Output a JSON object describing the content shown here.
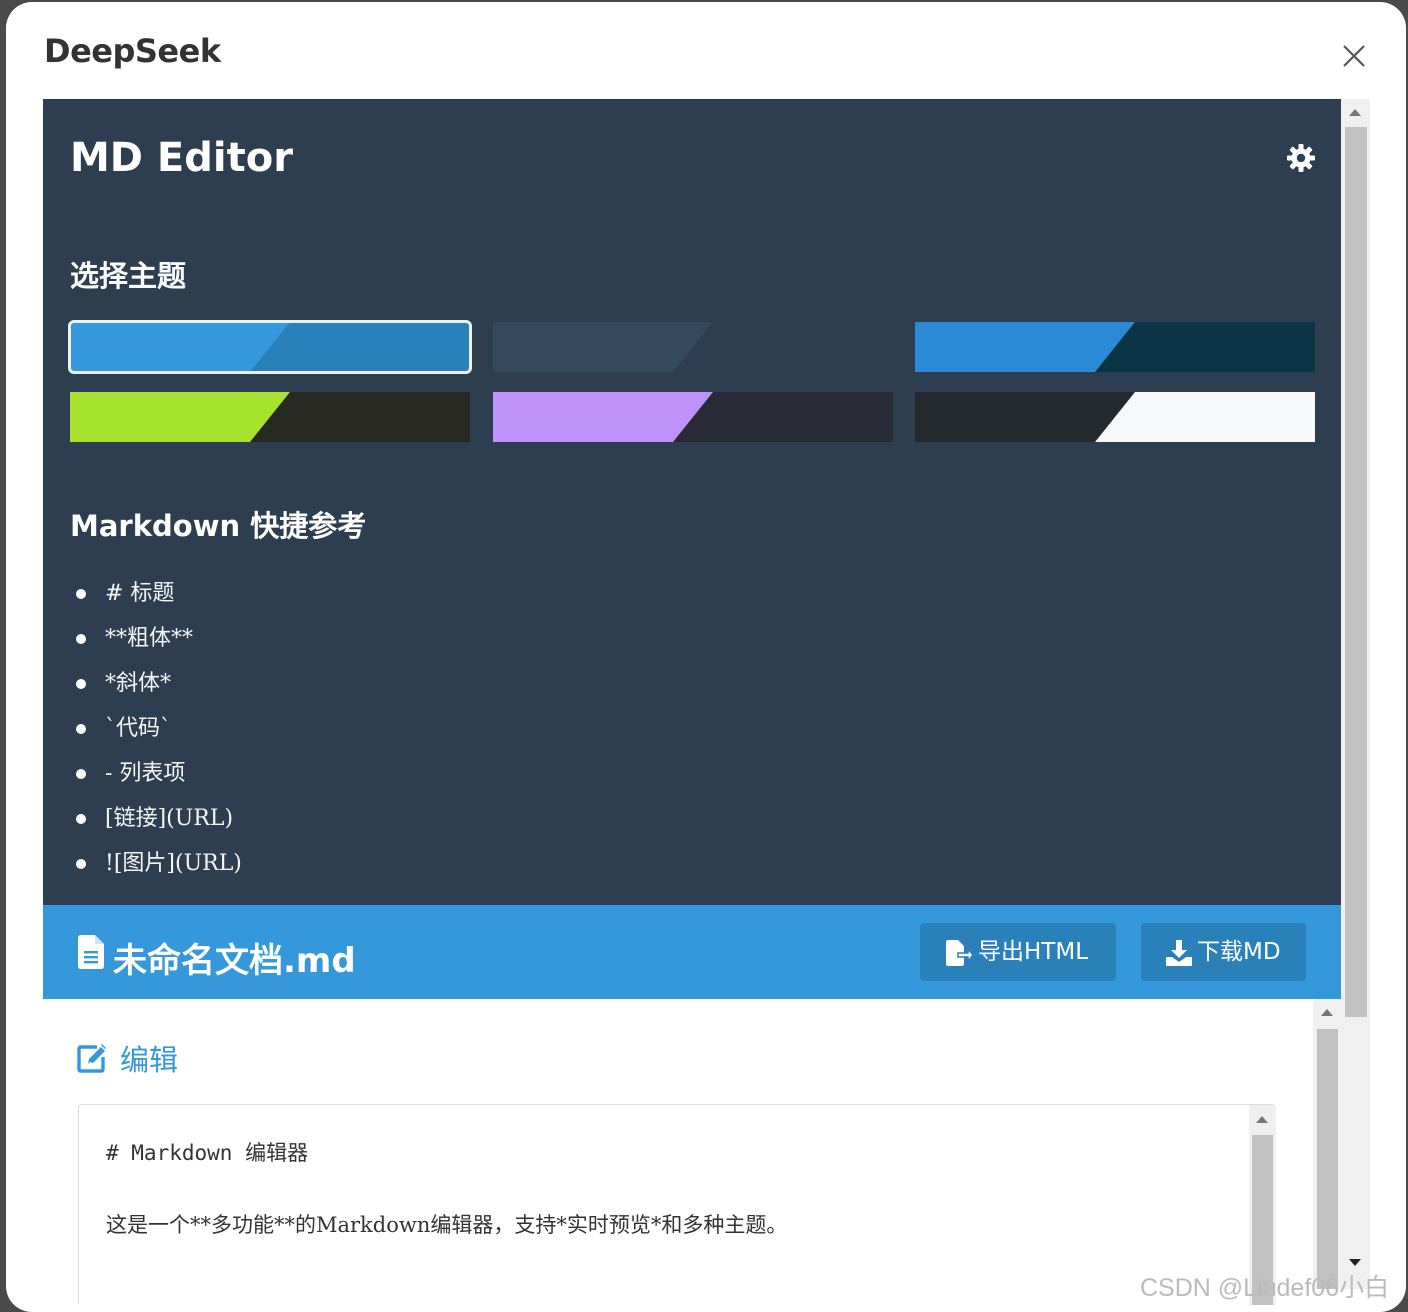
{
  "dialog": {
    "title": "DeepSeek"
  },
  "app": {
    "title": "MD Editor"
  },
  "themes": {
    "section_title": "选择主题",
    "options": [
      {
        "name": "blue",
        "primary": "#3498db",
        "secondary": "#2a80b9",
        "selected": true
      },
      {
        "name": "dark",
        "primary": "#34495e",
        "secondary": "#2c3e50",
        "selected": false
      },
      {
        "name": "ocean",
        "primary": "#2a8ad5",
        "secondary": "#0b3444",
        "selected": false
      },
      {
        "name": "lime",
        "primary": "#a6e22e",
        "secondary": "#272822",
        "selected": false
      },
      {
        "name": "purple",
        "primary": "#bd93f9",
        "secondary": "#282a36",
        "selected": false
      },
      {
        "name": "light",
        "primary": "#24292e",
        "secondary": "#f6f8fa",
        "selected": false
      }
    ]
  },
  "reference": {
    "section_title": "Markdown 快捷参考",
    "items": [
      "# 标题",
      "**粗体**",
      "*斜体*",
      "`代码`",
      "- 列表项",
      "[链接](URL)",
      "![图片](URL)"
    ]
  },
  "document": {
    "filename": "未命名文档.md",
    "export_html_label": "导出HTML",
    "download_md_label": "下载MD"
  },
  "editor": {
    "label": "编辑",
    "lines": [
      "# Markdown 编辑器",
      "这是一个**多功能**的Markdown编辑器，支持*实时预览*和多种主题。"
    ]
  },
  "watermark": "CSDN @Liudef06小白",
  "colors": {
    "sidebar": "#2c3e50",
    "accent": "#3498db",
    "button": "#2a80b9"
  }
}
